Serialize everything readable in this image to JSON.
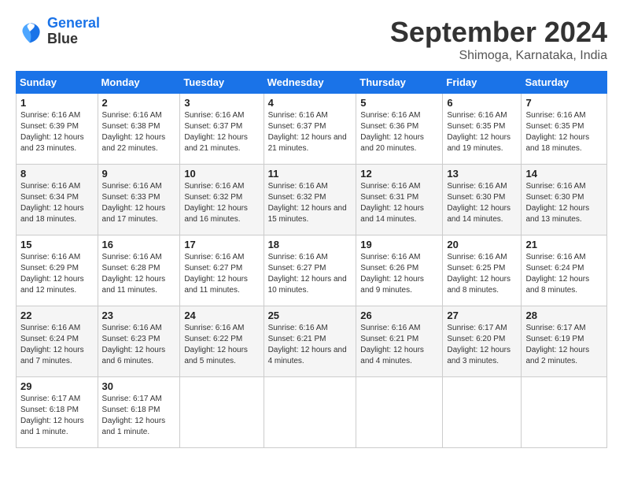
{
  "header": {
    "logo_line1": "General",
    "logo_line2": "Blue",
    "month": "September 2024",
    "location": "Shimoga, Karnataka, India"
  },
  "weekdays": [
    "Sunday",
    "Monday",
    "Tuesday",
    "Wednesday",
    "Thursday",
    "Friday",
    "Saturday"
  ],
  "weeks": [
    [
      {
        "day": "1",
        "sunrise": "6:16 AM",
        "sunset": "6:39 PM",
        "daylight": "12 hours and 23 minutes."
      },
      {
        "day": "2",
        "sunrise": "6:16 AM",
        "sunset": "6:38 PM",
        "daylight": "12 hours and 22 minutes."
      },
      {
        "day": "3",
        "sunrise": "6:16 AM",
        "sunset": "6:37 PM",
        "daylight": "12 hours and 21 minutes."
      },
      {
        "day": "4",
        "sunrise": "6:16 AM",
        "sunset": "6:37 PM",
        "daylight": "12 hours and 21 minutes."
      },
      {
        "day": "5",
        "sunrise": "6:16 AM",
        "sunset": "6:36 PM",
        "daylight": "12 hours and 20 minutes."
      },
      {
        "day": "6",
        "sunrise": "6:16 AM",
        "sunset": "6:35 PM",
        "daylight": "12 hours and 19 minutes."
      },
      {
        "day": "7",
        "sunrise": "6:16 AM",
        "sunset": "6:35 PM",
        "daylight": "12 hours and 18 minutes."
      }
    ],
    [
      {
        "day": "8",
        "sunrise": "6:16 AM",
        "sunset": "6:34 PM",
        "daylight": "12 hours and 18 minutes."
      },
      {
        "day": "9",
        "sunrise": "6:16 AM",
        "sunset": "6:33 PM",
        "daylight": "12 hours and 17 minutes."
      },
      {
        "day": "10",
        "sunrise": "6:16 AM",
        "sunset": "6:32 PM",
        "daylight": "12 hours and 16 minutes."
      },
      {
        "day": "11",
        "sunrise": "6:16 AM",
        "sunset": "6:32 PM",
        "daylight": "12 hours and 15 minutes."
      },
      {
        "day": "12",
        "sunrise": "6:16 AM",
        "sunset": "6:31 PM",
        "daylight": "12 hours and 14 minutes."
      },
      {
        "day": "13",
        "sunrise": "6:16 AM",
        "sunset": "6:30 PM",
        "daylight": "12 hours and 14 minutes."
      },
      {
        "day": "14",
        "sunrise": "6:16 AM",
        "sunset": "6:30 PM",
        "daylight": "12 hours and 13 minutes."
      }
    ],
    [
      {
        "day": "15",
        "sunrise": "6:16 AM",
        "sunset": "6:29 PM",
        "daylight": "12 hours and 12 minutes."
      },
      {
        "day": "16",
        "sunrise": "6:16 AM",
        "sunset": "6:28 PM",
        "daylight": "12 hours and 11 minutes."
      },
      {
        "day": "17",
        "sunrise": "6:16 AM",
        "sunset": "6:27 PM",
        "daylight": "12 hours and 11 minutes."
      },
      {
        "day": "18",
        "sunrise": "6:16 AM",
        "sunset": "6:27 PM",
        "daylight": "12 hours and 10 minutes."
      },
      {
        "day": "19",
        "sunrise": "6:16 AM",
        "sunset": "6:26 PM",
        "daylight": "12 hours and 9 minutes."
      },
      {
        "day": "20",
        "sunrise": "6:16 AM",
        "sunset": "6:25 PM",
        "daylight": "12 hours and 8 minutes."
      },
      {
        "day": "21",
        "sunrise": "6:16 AM",
        "sunset": "6:24 PM",
        "daylight": "12 hours and 8 minutes."
      }
    ],
    [
      {
        "day": "22",
        "sunrise": "6:16 AM",
        "sunset": "6:24 PM",
        "daylight": "12 hours and 7 minutes."
      },
      {
        "day": "23",
        "sunrise": "6:16 AM",
        "sunset": "6:23 PM",
        "daylight": "12 hours and 6 minutes."
      },
      {
        "day": "24",
        "sunrise": "6:16 AM",
        "sunset": "6:22 PM",
        "daylight": "12 hours and 5 minutes."
      },
      {
        "day": "25",
        "sunrise": "6:16 AM",
        "sunset": "6:21 PM",
        "daylight": "12 hours and 4 minutes."
      },
      {
        "day": "26",
        "sunrise": "6:16 AM",
        "sunset": "6:21 PM",
        "daylight": "12 hours and 4 minutes."
      },
      {
        "day": "27",
        "sunrise": "6:17 AM",
        "sunset": "6:20 PM",
        "daylight": "12 hours and 3 minutes."
      },
      {
        "day": "28",
        "sunrise": "6:17 AM",
        "sunset": "6:19 PM",
        "daylight": "12 hours and 2 minutes."
      }
    ],
    [
      {
        "day": "29",
        "sunrise": "6:17 AM",
        "sunset": "6:18 PM",
        "daylight": "12 hours and 1 minute."
      },
      {
        "day": "30",
        "sunrise": "6:17 AM",
        "sunset": "6:18 PM",
        "daylight": "12 hours and 1 minute."
      },
      null,
      null,
      null,
      null,
      null
    ]
  ]
}
